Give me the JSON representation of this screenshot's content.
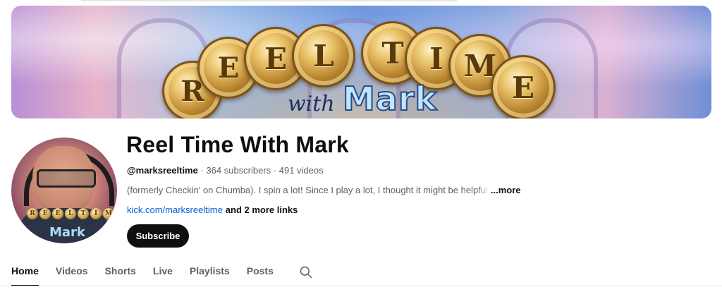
{
  "banner": {
    "letters": [
      "R",
      "E",
      "E",
      "L",
      "T",
      "I",
      "M",
      "E"
    ],
    "script_with": "with",
    "script_name": "Mark"
  },
  "avatar": {
    "letters": [
      "R",
      "E",
      "E",
      "L",
      "T",
      "I",
      "M",
      "E"
    ],
    "name_text": "Mark"
  },
  "channel": {
    "title": "Reel Time With Mark",
    "handle": "@marksreeltime",
    "subscribers": " · 364 subscribers · 491 videos",
    "description": "(formerly Checkin' on Chumba). I spin a lot!   Since I play a lot, I thought it might be ",
    "description_fade": "helpful",
    "more_label": "...more",
    "link_text": "kick.com/marksreeltime",
    "more_links": "and 2 more links",
    "subscribe_label": "Subscribe"
  },
  "tabs": [
    {
      "label": "Home",
      "active": true
    },
    {
      "label": "Videos",
      "active": false
    },
    {
      "label": "Shorts",
      "active": false
    },
    {
      "label": "Live",
      "active": false
    },
    {
      "label": "Playlists",
      "active": false
    },
    {
      "label": "Posts",
      "active": false
    }
  ],
  "icons": {
    "search": "search-icon"
  },
  "colors": {
    "link": "#065fd4",
    "button_bg": "#0f0f0f",
    "muted": "#606060"
  }
}
